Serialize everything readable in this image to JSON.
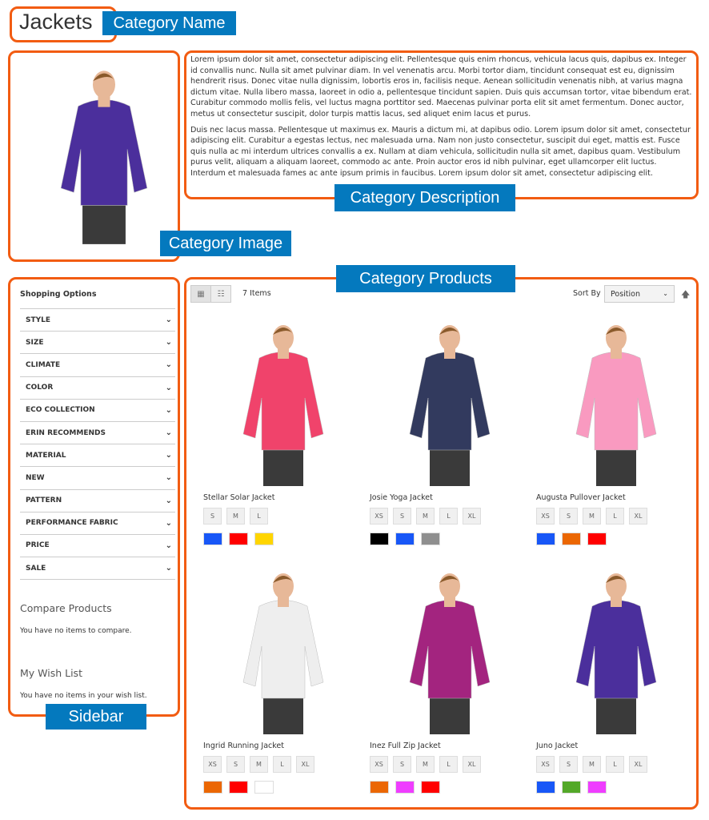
{
  "annotations": {
    "name": "Category Name",
    "image": "Category Image",
    "description": "Category Description",
    "products": "Category Products",
    "sidebar": "Sidebar"
  },
  "category": {
    "title": "Jackets",
    "image_jacket_color": "#4b2f9c",
    "description": [
      "Lorem ipsum dolor sit amet, consectetur adipiscing elit. Pellentesque quis enim rhoncus, vehicula lacus quis, dapibus ex. Integer id convallis nunc. Nulla sit amet pulvinar diam. In vel venenatis arcu. Morbi tortor diam, tincidunt consequat est eu, dignissim hendrerit risus. Donec vitae nulla dignissim, lobortis eros in, facilisis neque. Aenean sollicitudin venenatis nibh, at varius magna dictum vitae. Nulla libero massa, laoreet in odio a, pellentesque tincidunt sapien. Duis quis accumsan tortor, vitae bibendum erat. Curabitur commodo mollis felis, vel luctus magna porttitor sed. Maecenas pulvinar porta elit sit amet fermentum. Donec auctor, metus ut consectetur suscipit, dolor turpis mattis lacus, sed aliquet enim lacus et purus.",
      "Duis nec lacus massa. Pellentesque ut maximus ex. Mauris a dictum mi, at dapibus odio. Lorem ipsum dolor sit amet, consectetur adipiscing elit. Curabitur a egestas lectus, nec malesuada urna. Nam non justo consectetur, suscipit dui eget, mattis est. Fusce quis nulla ac mi interdum ultrices convallis a ex. Nullam at diam vehicula, sollicitudin nulla sit amet, dapibus quam. Vestibulum purus velit, aliquam a aliquam laoreet, commodo ac ante. Proin auctor eros id nibh pulvinar, eget ullamcorper elit luctus. Interdum et malesuada fames ac ante ipsum primis in faucibus. Lorem ipsum dolor sit amet, consectetur adipiscing elit."
    ]
  },
  "sidebar": {
    "heading": "Shopping Options",
    "filters": [
      "STYLE",
      "SIZE",
      "CLIMATE",
      "COLOR",
      "ECO COLLECTION",
      "ERIN RECOMMENDS",
      "MATERIAL",
      "NEW",
      "PATTERN",
      "PERFORMANCE FABRIC",
      "PRICE",
      "SALE"
    ],
    "compare": {
      "title": "Compare Products",
      "text": "You have no items to compare."
    },
    "wishlist": {
      "title": "My Wish List",
      "text": "You have no items in your wish list."
    }
  },
  "toolbar": {
    "count": "7 Items",
    "sort_label": "Sort By",
    "sort_value": "Position",
    "view_modes": [
      "grid",
      "list"
    ],
    "active_mode": "grid"
  },
  "products": [
    {
      "name": "Stellar Solar Jacket",
      "jacket": "#f0436b",
      "sizes": [
        "S",
        "M",
        "L"
      ],
      "colors": [
        "#1857f7",
        "#ff0000",
        "#ffd500"
      ]
    },
    {
      "name": "Josie Yoga Jacket",
      "jacket": "#323a5e",
      "sizes": [
        "XS",
        "S",
        "M",
        "L",
        "XL"
      ],
      "colors": [
        "#000000",
        "#1857f7",
        "#8f8f8f"
      ]
    },
    {
      "name": "Augusta Pullover Jacket",
      "jacket": "#f99ac0",
      "sizes": [
        "XS",
        "S",
        "M",
        "L",
        "XL"
      ],
      "colors": [
        "#1857f7",
        "#eb6703",
        "#ff0000"
      ]
    },
    {
      "name": "Ingrid Running Jacket",
      "jacket": "#eeeeee",
      "sizes": [
        "XS",
        "S",
        "M",
        "L",
        "XL"
      ],
      "colors": [
        "#eb6703",
        "#ff0000",
        "#ffffff"
      ]
    },
    {
      "name": "Inez Full Zip Jacket",
      "jacket": "#a3247f",
      "sizes": [
        "XS",
        "S",
        "M",
        "L",
        "XL"
      ],
      "colors": [
        "#eb6703",
        "#ef3dff",
        "#ff0000"
      ]
    },
    {
      "name": "Juno Jacket",
      "jacket": "#4b2f9c",
      "sizes": [
        "XS",
        "S",
        "M",
        "L",
        "XL"
      ],
      "colors": [
        "#1857f7",
        "#53a828",
        "#ef3dff"
      ]
    }
  ]
}
